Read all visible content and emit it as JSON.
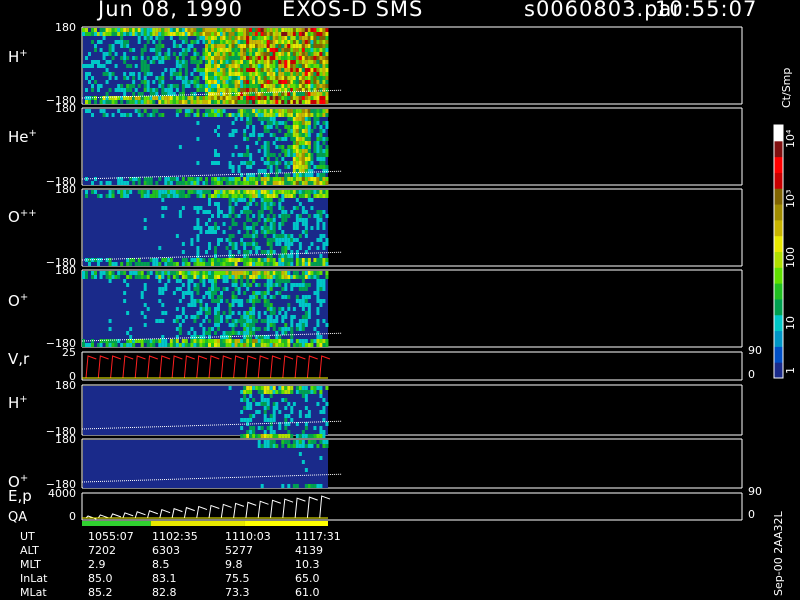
{
  "header": {
    "date": "Jun 08, 1990",
    "mission": "EXOS-D SMS",
    "file": "s0060803.par",
    "time": "10:55:07"
  },
  "colorbar": {
    "title": "Ct/Smp",
    "ticks": [
      "10⁴",
      "10³",
      "100",
      "10",
      "1"
    ],
    "colors": [
      "#1a2a8a",
      "#0050c8",
      "#0096c8",
      "#00c8c8",
      "#00a050",
      "#20c020",
      "#60e000",
      "#b0e000",
      "#e8e800",
      "#c8b400",
      "#a08c00",
      "#806400",
      "#c80000",
      "#ff0000",
      "#801010",
      "#ffffff"
    ]
  },
  "side_note": "Sep-00 2AA32L",
  "chart_data": [
    {
      "type": "heatmap",
      "panel_label": "H",
      "panel_label_sup": "+",
      "y_ticks": [
        "180",
        "−180"
      ],
      "ylim": [
        -180,
        180
      ],
      "intensity": [
        0.5,
        0.55,
        0.6,
        0.62,
        0.65,
        0.68,
        0.7,
        0.72,
        0.8,
        0.9,
        0.95,
        0.95,
        0.95,
        0.9
      ]
    },
    {
      "type": "heatmap",
      "panel_label": "He",
      "panel_label_sup": "+",
      "y_ticks": [
        "180",
        "−180"
      ],
      "ylim": [
        -180,
        180
      ],
      "intensity": [
        0.25,
        0.28,
        0.3,
        0.32,
        0.35,
        0.38,
        0.4,
        0.42,
        0.45,
        0.55,
        0.65,
        0.7,
        0.75,
        0.7
      ]
    },
    {
      "type": "heatmap",
      "panel_label": "O",
      "panel_label_sup": "++",
      "y_ticks": [
        "180",
        "−180"
      ],
      "ylim": [
        -180,
        180
      ],
      "intensity": [
        0.3,
        0.32,
        0.35,
        0.38,
        0.4,
        0.42,
        0.45,
        0.5,
        0.55,
        0.62,
        0.65,
        0.6,
        0.55,
        0.5
      ]
    },
    {
      "type": "heatmap",
      "panel_label": "O",
      "panel_label_sup": "+",
      "y_ticks": [
        "180",
        "−180"
      ],
      "ylim": [
        -180,
        180
      ],
      "intensity": [
        0.35,
        0.38,
        0.4,
        0.42,
        0.45,
        0.5,
        0.55,
        0.6,
        0.65,
        0.7,
        0.68,
        0.62,
        0.55,
        0.5
      ]
    },
    {
      "type": "line",
      "panel_label": "V,r",
      "y_ticks": [
        "25",
        "0"
      ],
      "right_ticks": [
        "90",
        "0"
      ],
      "ylim": [
        0,
        25
      ]
    },
    {
      "type": "heatmap",
      "panel_label": "H",
      "panel_label_sup": "+",
      "y_ticks": [
        "180",
        "−180"
      ],
      "ylim": [
        -180,
        180
      ],
      "intensity": [
        0.05,
        0.05,
        0.05,
        0.05,
        0.05,
        0.05,
        0.05,
        0.1,
        0.2,
        0.55,
        0.6,
        0.55,
        0.5,
        0.45
      ]
    },
    {
      "type": "heatmap",
      "panel_label": "O",
      "panel_label_sup": "+",
      "y_ticks": [
        "180",
        "−180"
      ],
      "ylim": [
        -180,
        180
      ],
      "intensity": [
        0.05,
        0.05,
        0.05,
        0.05,
        0.05,
        0.05,
        0.05,
        0.05,
        0.1,
        0.2,
        0.3,
        0.35,
        0.4,
        0.35
      ]
    },
    {
      "type": "line",
      "panel_label": "E,p",
      "y_ticks": [
        "4000",
        "0"
      ],
      "right_ticks": [
        "90",
        "0"
      ],
      "ylim": [
        0,
        4000
      ]
    }
  ],
  "qa": {
    "label": "QA",
    "segments": [
      {
        "from": 0.0,
        "to": 0.28,
        "color": "#30d030"
      },
      {
        "from": 0.28,
        "to": 0.66,
        "color": "#e8e800"
      },
      {
        "from": 0.66,
        "to": 1.0,
        "color": "#ffff00"
      }
    ]
  },
  "ephemeris": {
    "rows": [
      {
        "label": "UT",
        "values": [
          "1055:07",
          "1102:35",
          "1110:03",
          "1117:31"
        ]
      },
      {
        "label": "ALT",
        "values": [
          "7202",
          "6303",
          "5277",
          "4139"
        ]
      },
      {
        "label": "MLT",
        "values": [
          "2.9",
          "8.5",
          "9.8",
          "10.3"
        ]
      },
      {
        "label": "InLat",
        "values": [
          "85.0",
          "83.1",
          "75.5",
          "65.0"
        ]
      },
      {
        "label": "MLat",
        "values": [
          "85.2",
          "82.8",
          "73.3",
          "61.0"
        ]
      }
    ]
  }
}
